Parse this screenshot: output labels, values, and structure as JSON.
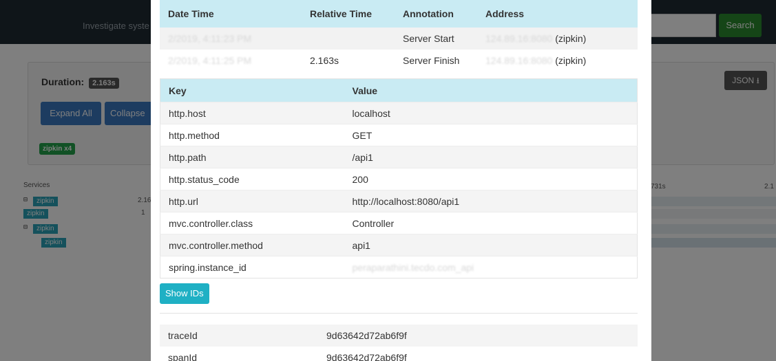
{
  "background": {
    "nav_hint": "Investigate syste",
    "search_button": "Search",
    "duration_label": "Duration:",
    "duration_value": "2.163s",
    "expand_all": "Expand All",
    "collapse": "Collapse",
    "service_tag": "zipkin x4",
    "json_button": "JSON",
    "services_label": "Services",
    "services": [
      "zipkin",
      "zipkin",
      "zipkin",
      "zipkin"
    ],
    "timeline_left": [
      "2.16",
      "1",
      "",
      ""
    ],
    "timeline_right_label_a": "731s",
    "timeline_right_label_b": "2.1"
  },
  "annotations": {
    "headers": [
      "Date Time",
      "Relative Time",
      "Annotation",
      "Address"
    ],
    "rows": [
      {
        "datetime": "2/2019, 4:11:23 PM",
        "relative": "",
        "annotation": "Server Start",
        "address_hidden": "124.89.16:8080",
        "address_suffix": "(zipkin)"
      },
      {
        "datetime": "2/2019, 4:11:25 PM",
        "relative": "2.163s",
        "annotation": "Server Finish",
        "address_hidden": "124.89.16:8080",
        "address_suffix": "(zipkin)"
      }
    ]
  },
  "tags": {
    "headers": [
      "Key",
      "Value"
    ],
    "rows": [
      {
        "key": "http.host",
        "value": "localhost"
      },
      {
        "key": "http.method",
        "value": "GET"
      },
      {
        "key": "http.path",
        "value": "/api1"
      },
      {
        "key": "http.status_code",
        "value": "200"
      },
      {
        "key": "http.url",
        "value": "http://localhost:8080/api1"
      },
      {
        "key": "mvc.controller.class",
        "value": "Controller"
      },
      {
        "key": "mvc.controller.method",
        "value": "api1"
      },
      {
        "key": "spring.instance_id",
        "value": "peraparathini.tecdo.com_api"
      }
    ]
  },
  "show_ids_button": "Show IDs",
  "ids": {
    "rows": [
      {
        "key": "traceId",
        "value": "9d63642d72ab6f9f"
      },
      {
        "key": "spanId",
        "value": "9d63642d72ab6f9f"
      }
    ]
  }
}
